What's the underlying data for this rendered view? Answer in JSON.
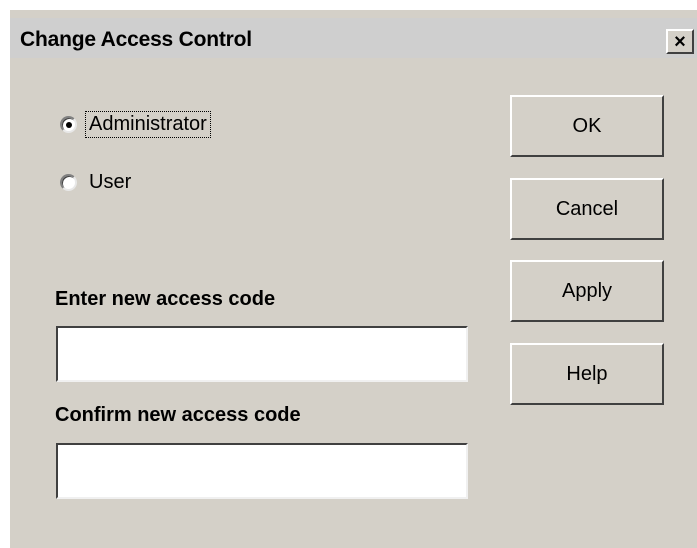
{
  "dialog": {
    "title": "Change Access Control",
    "close_label": "×"
  },
  "roles": [
    {
      "label": "Administrator",
      "selected": true
    },
    {
      "label": "User",
      "selected": false
    }
  ],
  "fields": {
    "new_code": {
      "label": "Enter new access code",
      "value": ""
    },
    "confirm_code": {
      "label": "Confirm new access code",
      "value": ""
    }
  },
  "buttons": {
    "ok": "OK",
    "cancel": "Cancel",
    "apply": "Apply",
    "help": "Help"
  }
}
